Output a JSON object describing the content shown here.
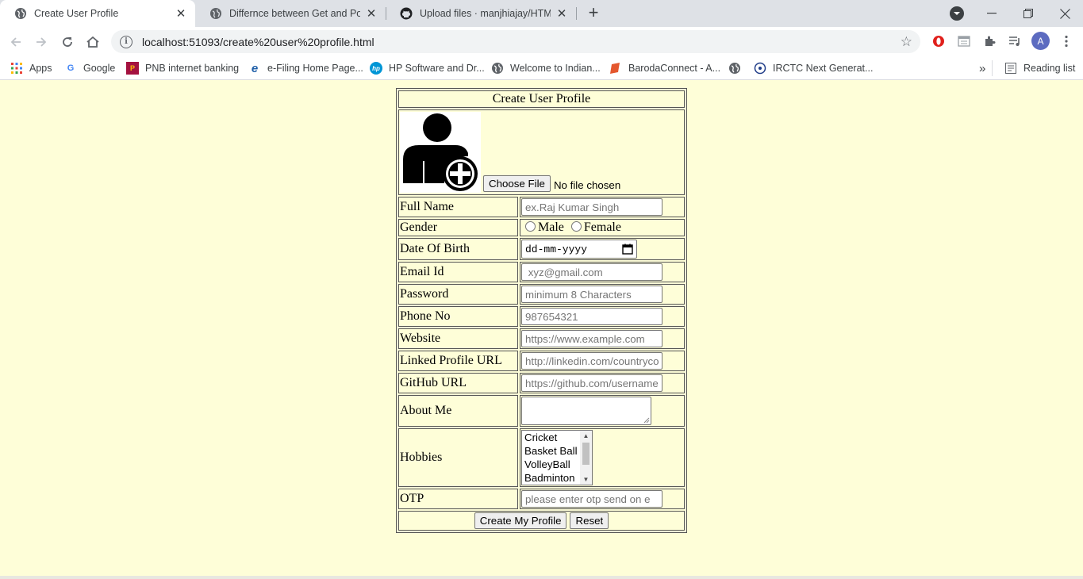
{
  "browser": {
    "tabs": [
      {
        "title": "Create User Profile",
        "active": true,
        "icon": "globe-icon"
      },
      {
        "title": "Differnce between Get and Post f",
        "active": false,
        "icon": "globe-icon"
      },
      {
        "title": "Upload files · manjhiajay/HTML-F",
        "active": false,
        "icon": "github-icon"
      }
    ],
    "new_tab_label": "+",
    "address": "localhost:51093/create%20user%20profile.html",
    "profile_initial": "A",
    "bookmarks": [
      {
        "label": "Apps",
        "icon": "apps-grid-icon"
      },
      {
        "label": "Google",
        "icon": "google-icon"
      },
      {
        "label": "PNB internet banking",
        "icon": "pnb-icon"
      },
      {
        "label": "e-Filing Home Page...",
        "icon": "ie-icon"
      },
      {
        "label": "HP Software and Dr...",
        "icon": "hp-icon"
      },
      {
        "label": "Welcome to Indian...",
        "icon": "globe-icon"
      },
      {
        "label": "BarodaConnect - A...",
        "icon": "baroda-icon"
      },
      {
        "label": "",
        "icon": "globe-icon"
      },
      {
        "label": "IRCTC Next Generat...",
        "icon": "irctc-icon"
      }
    ],
    "overflow_label": "»",
    "reading_list_label": "Reading list"
  },
  "form": {
    "title": "Create User Profile",
    "choose_file_label": "Choose File",
    "no_file_label": "No file chosen",
    "full_name": {
      "label": "Full Name",
      "placeholder": "ex.Raj Kumar Singh"
    },
    "gender": {
      "label": "Gender",
      "options": [
        "Male",
        "Female"
      ]
    },
    "dob": {
      "label": "Date Of Birth",
      "placeholder": "dd-mm-yyyy"
    },
    "email": {
      "label": "Email Id",
      "placeholder": " xyz@gmail.com"
    },
    "password": {
      "label": "Password",
      "placeholder": "minimum 8 Characters"
    },
    "phone": {
      "label": "Phone No",
      "placeholder": "987654321"
    },
    "website": {
      "label": "Website",
      "placeholder": "https://www.example.com"
    },
    "linkedin": {
      "label": "Linked Profile URL",
      "placeholder": "http://linkedin.com/countryco"
    },
    "github": {
      "label": "GitHub URL",
      "placeholder": "https://github.com/username"
    },
    "about": {
      "label": "About Me"
    },
    "hobbies": {
      "label": "Hobbies",
      "options": [
        "Cricket",
        "Basket Ball",
        "VolleyBall",
        "Badminton"
      ]
    },
    "otp": {
      "label": "OTP",
      "placeholder": "please enter otp send on e"
    },
    "submit_label": "Create My Profile",
    "reset_label": "Reset"
  }
}
